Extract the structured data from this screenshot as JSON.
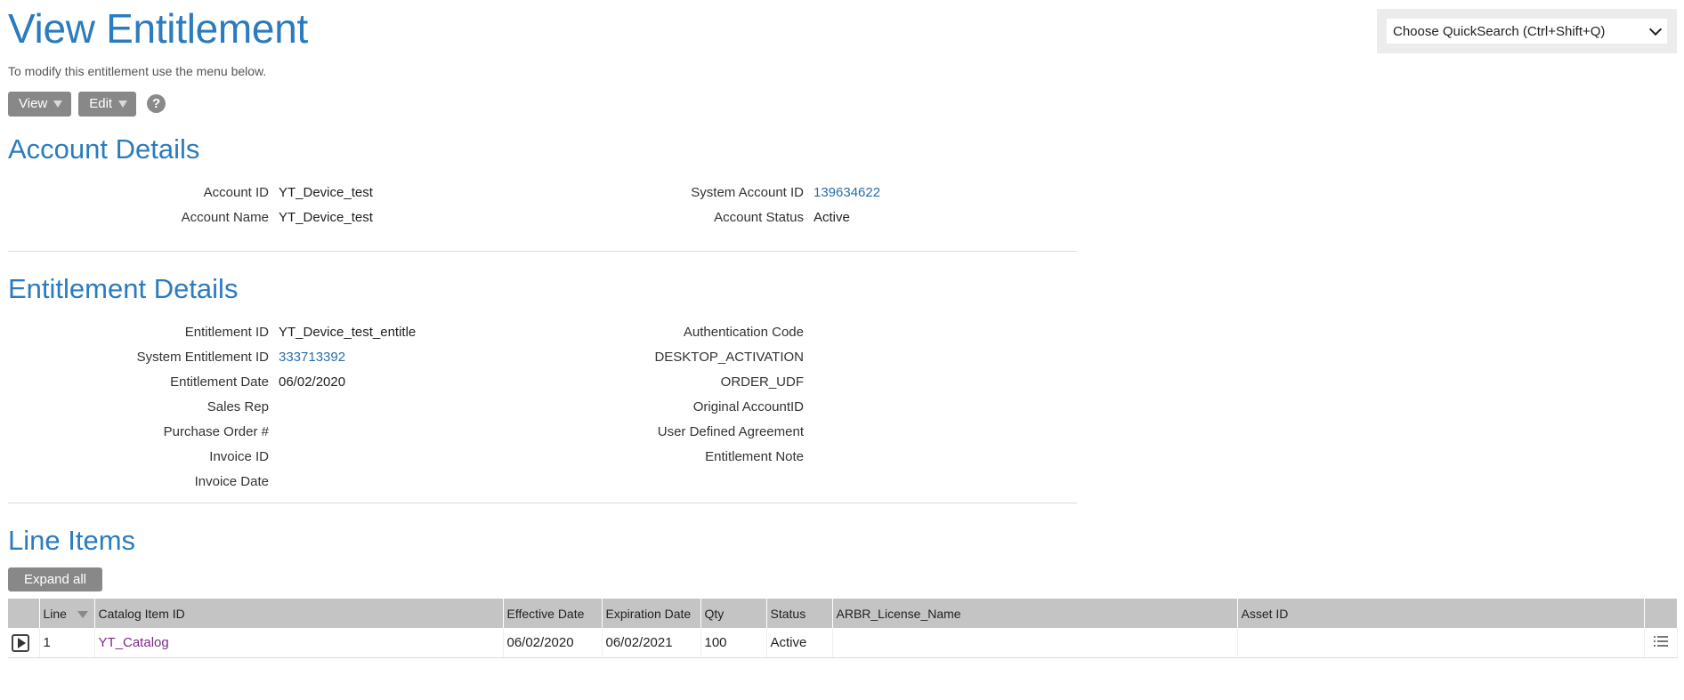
{
  "header": {
    "title": "View Entitlement",
    "subtitle": "To modify this entitlement use the menu below.",
    "view_label": "View",
    "edit_label": "Edit",
    "help_symbol": "?"
  },
  "quicksearch": {
    "selected": "Choose QuickSearch (Ctrl+Shift+Q)"
  },
  "account": {
    "section_title": "Account Details",
    "left": [
      {
        "label": "Account ID",
        "value": "YT_Device_test"
      },
      {
        "label": "Account Name",
        "value": "YT_Device_test"
      }
    ],
    "right": [
      {
        "label": "System Account ID",
        "value": "139634622"
      },
      {
        "label": "Account Status",
        "value": "Active"
      }
    ]
  },
  "entitlement": {
    "section_title": "Entitlement Details",
    "left": [
      {
        "label": "Entitlement ID",
        "value": "YT_Device_test_entitle"
      },
      {
        "label": "System Entitlement ID",
        "value": "333713392"
      },
      {
        "label": "Entitlement Date",
        "value": "06/02/2020"
      },
      {
        "label": "Sales Rep",
        "value": ""
      },
      {
        "label": "Purchase Order #",
        "value": ""
      },
      {
        "label": "Invoice ID",
        "value": ""
      },
      {
        "label": "Invoice Date",
        "value": ""
      }
    ],
    "right": [
      {
        "label": "Authentication Code",
        "value": ""
      },
      {
        "label": "DESKTOP_ACTIVATION",
        "value": ""
      },
      {
        "label": "ORDER_UDF",
        "value": ""
      },
      {
        "label": "Original AccountID",
        "value": ""
      },
      {
        "label": "User Defined Agreement",
        "value": ""
      },
      {
        "label": "Entitlement Note",
        "value": ""
      }
    ]
  },
  "line_items": {
    "section_title": "Line Items",
    "expand_label": "Expand all",
    "columns": [
      "Line",
      "Catalog Item ID",
      "Effective Date",
      "Expiration Date",
      "Qty",
      "Status",
      "ARBR_License_Name",
      "Asset ID"
    ],
    "rows": [
      {
        "line": "1",
        "catalog": "YT_Catalog",
        "effective": "06/02/2020",
        "expiration": "06/02/2021",
        "qty": "100",
        "status": "Active",
        "license": "",
        "asset": ""
      }
    ]
  },
  "icons": {
    "help": "help-icon",
    "expand_row": "play-icon",
    "row_menu": "list-icon",
    "sort": "sort-caret-icon"
  },
  "colors": {
    "heading_blue": "#2b7bbf",
    "link_blue": "#2a6fa8",
    "visited_purple": "#7b2a86",
    "button_gray": "#888888",
    "table_header_gray": "#c4c4c4"
  }
}
